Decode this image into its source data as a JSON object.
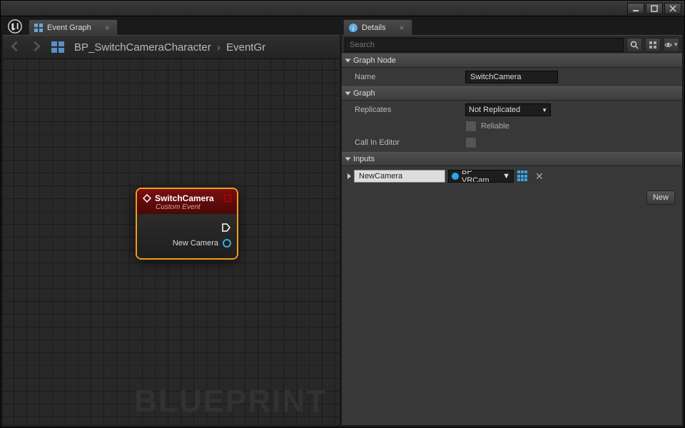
{
  "window_controls": {
    "min": "minimize",
    "max": "maximize",
    "close": "close"
  },
  "left_panel": {
    "tab_label": "Event Graph",
    "breadcrumb": {
      "parent": "BP_SwitchCameraCharacter",
      "current": "EventGr"
    },
    "node": {
      "title": "SwitchCamera",
      "subtitle": "Custom Event",
      "output_pin": "New Camera"
    },
    "watermark": "BLUEPRINT"
  },
  "right_panel": {
    "tab_label": "Details",
    "search_placeholder": "Search",
    "categories": {
      "graph_node": "Graph Node",
      "graph": "Graph",
      "inputs": "Inputs"
    },
    "props": {
      "name_label": "Name",
      "name_value": "SwitchCamera",
      "replicates_label": "Replicates",
      "replicates_value": "Not Replicated",
      "reliable_label": "Reliable",
      "callineditor_label": "Call In Editor"
    },
    "inputs": {
      "param_name": "NewCamera",
      "param_type": "BP VRCam"
    },
    "new_button": "New"
  }
}
